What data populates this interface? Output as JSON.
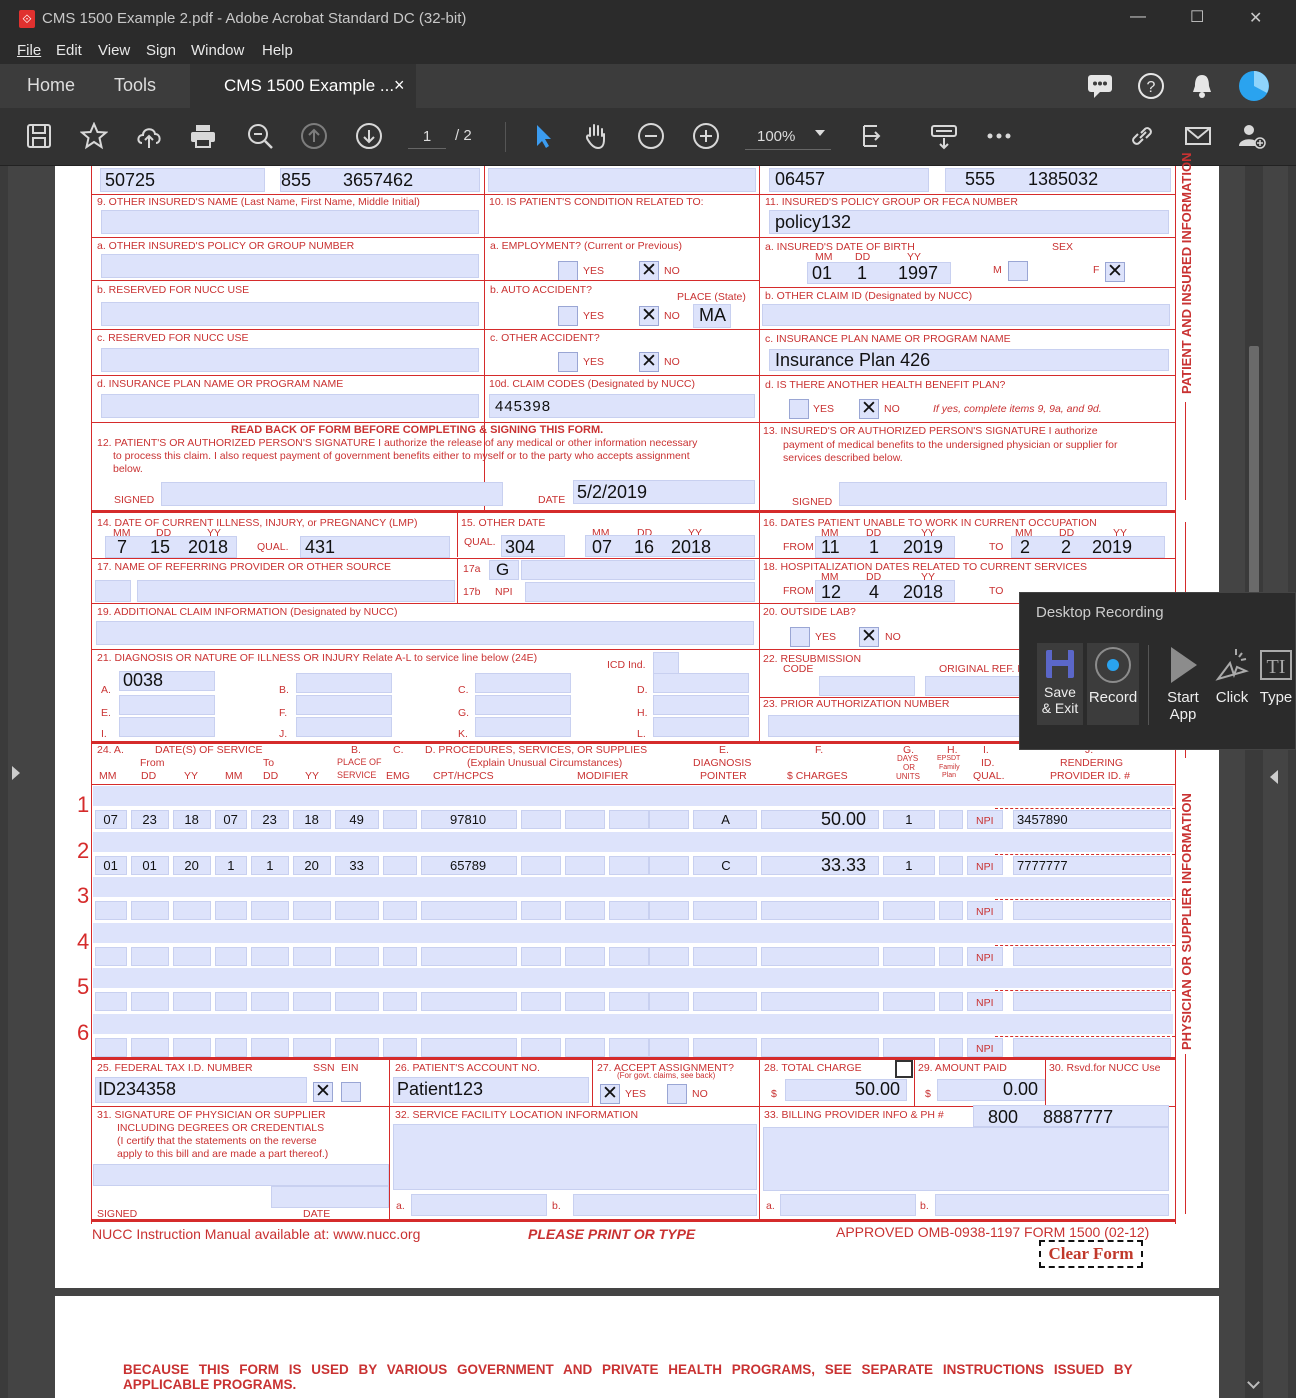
{
  "window": {
    "title": "CMS 1500 Example 2.pdf - Adobe Acrobat Standard DC (32-bit)",
    "min": "—",
    "max": "☐",
    "close": "✕"
  },
  "menu": [
    "File",
    "Edit",
    "View",
    "Sign",
    "Window",
    "Help"
  ],
  "tabs": {
    "home": "Home",
    "tools": "Tools",
    "doc": "CMS 1500 Example ...",
    "doc_close": "×"
  },
  "toolbar": {
    "page_current": "1",
    "page_total": "/ 2",
    "zoom": "100%"
  },
  "form": {
    "top": {
      "zip": "50725",
      "area": "855",
      "phone": "3657462",
      "ins_zip": "06457",
      "ins_area": "555",
      "ins_phone": "1385032"
    },
    "l9": "9. OTHER INSURED'S NAME (Last Name, First Name, Middle Initial)",
    "l9a": "a. OTHER INSURED'S POLICY OR GROUP NUMBER",
    "l9b": "b. RESERVED FOR NUCC USE",
    "l9c": "c. RESERVED FOR NUCC USE",
    "l9d": "d. INSURANCE PLAN NAME OR PROGRAM NAME",
    "l10": "10. IS PATIENT'S CONDITION RELATED TO:",
    "l10a": "a. EMPLOYMENT? (Current or Previous)",
    "l10b": "b. AUTO ACCIDENT?",
    "l10b_place": "PLACE (State)",
    "l10c": "c. OTHER ACCIDENT?",
    "l10d": "10d. CLAIM CODES (Designated by NUCC)",
    "yes": "YES",
    "no": "NO",
    "auto_state": "MA",
    "claim_codes": "445398",
    "l11": "11. INSURED'S POLICY GROUP OR FECA NUMBER",
    "policy": "policy132",
    "l11a": "a. INSURED'S DATE OF BIRTH",
    "sex": "SEX",
    "mm": "MM",
    "dd": "DD",
    "yy": "YY",
    "m": "M",
    "f": "F",
    "dob": {
      "mm": "01",
      "dd": "1",
      "yy": "1997"
    },
    "l11b": "b. OTHER CLAIM ID (Designated by NUCC)",
    "l11c": "c. INSURANCE PLAN NAME OR PROGRAM NAME",
    "plan": "Insurance Plan 426",
    "l11d": "d. IS THERE ANOTHER HEALTH BENEFIT PLAN?",
    "l11d_note": "If yes, complete items 9, 9a, and 9d.",
    "readback": "READ BACK OF FORM BEFORE COMPLETING & SIGNING THIS FORM.",
    "l12": "12. PATIENT'S OR AUTHORIZED PERSON'S SIGNATURE  I authorize the release of any medical or other information necessary",
    "l12b": "to process this claim. I also request payment of government benefits either to myself or to the party who accepts assignment",
    "l12c": "below.",
    "signed": "SIGNED",
    "date": "DATE",
    "sign_date": "5/2/2019",
    "l13": "13. INSURED'S OR AUTHORIZED PERSON'S SIGNATURE I authorize",
    "l13b": "payment of medical benefits to the undersigned physician or supplier for",
    "l13c": "services described below.",
    "l14": "14. DATE OF CURRENT ILLNESS, INJURY, or PREGNANCY (LMP)",
    "d14": {
      "mm": "7",
      "dd": "15",
      "yy": "2018",
      "qual": "431"
    },
    "qual": "QUAL.",
    "l15": "15. OTHER DATE",
    "d15": {
      "qual": "304",
      "mm": "07",
      "dd": "16",
      "yy": "2018"
    },
    "l16": "16. DATES PATIENT UNABLE TO WORK IN CURRENT OCCUPATION",
    "from": "FROM",
    "to": "TO",
    "d16": {
      "fmm": "11",
      "fdd": "1",
      "fyy": "2019",
      "tmm": "2",
      "tdd": "2",
      "tyy": "2019"
    },
    "l17": "17. NAME OF REFERRING PROVIDER OR OTHER SOURCE",
    "l17a": "17a",
    "l17b": "17b",
    "npi": "NPI",
    "v17a": "G",
    "l18": "18. HOSPITALIZATION DATES RELATED TO CURRENT SERVICES",
    "d18": {
      "fmm": "12",
      "fdd": "4",
      "fyy": "2018",
      "tmm": "1",
      "tdd": "3",
      "tyy": "2018"
    },
    "l19": "19. ADDITIONAL CLAIM INFORMATION (Designated by NUCC)",
    "l20": "20. OUTSIDE LAB?",
    "charges_lbl": "$ CHARGES",
    "l21": "21. DIAGNOSIS OR NATURE OF ILLNESS OR INJURY  Relate A-L to service line below (24E)",
    "icd": "ICD Ind.",
    "diag_a": "0038",
    "diag_letters": [
      "A.",
      "B.",
      "C.",
      "D.",
      "E.",
      "F.",
      "G.",
      "H.",
      "I.",
      "J.",
      "K.",
      "L."
    ],
    "l22": "22. RESUBMISSION",
    "l22b": "CODE",
    "l22c": "ORIGINAL REF. NO.",
    "l23": "23. PRIOR AUTHORIZATION NUMBER",
    "h24": {
      "a": "24.  A.",
      "dates": "DATE(S) OF SERVICE",
      "from": "From",
      "to": "To",
      "b": "B.",
      "pos": "PLACE OF",
      "svc": "SERVICE",
      "c": "C.",
      "emg": "EMG",
      "d": "D.  PROCEDURES, SERVICES, OR SUPPLIES",
      "d2": "(Explain Unusual Circumstances)",
      "cpt": "CPT/HCPCS",
      "mod": "MODIFIER",
      "e": "E.",
      "diag": "DIAGNOSIS",
      "ptr": "POINTER",
      "f": "F.",
      "chg": "$ CHARGES",
      "g": "G.",
      "days": "DAYS",
      "or": "OR",
      "units": "UNITS",
      "h": "H.",
      "epsdt": "EPSDT",
      "family": "Family",
      "plan": "Plan",
      "i": "I.",
      "id": "ID.",
      "iqual": "QUAL.",
      "j": "J.",
      "rend": "RENDERING",
      "prov": "PROVIDER ID. #"
    },
    "lines": [
      {
        "n": "1",
        "fmm": "07",
        "fdd": "23",
        "fyy": "18",
        "tmm": "07",
        "tdd": "23",
        "tyy": "18",
        "pos": "49",
        "cpt": "97810",
        "ptr": "A",
        "chg": "50.00",
        "units": "1",
        "prov": "3457890"
      },
      {
        "n": "2",
        "fmm": "01",
        "fdd": "01",
        "fyy": "20",
        "tmm": "1",
        "tdd": "1",
        "tyy": "20",
        "pos": "33",
        "cpt": "65789",
        "ptr": "C",
        "chg": "33.33",
        "units": "1",
        "prov": "7777777"
      },
      {
        "n": "3",
        "fmm": "",
        "fdd": "",
        "fyy": "",
        "tmm": "",
        "tdd": "",
        "tyy": "",
        "pos": "",
        "cpt": "",
        "ptr": "",
        "chg": "",
        "units": "",
        "prov": ""
      },
      {
        "n": "4",
        "fmm": "",
        "fdd": "",
        "fyy": "",
        "tmm": "",
        "tdd": "",
        "tyy": "",
        "pos": "",
        "cpt": "",
        "ptr": "",
        "chg": "",
        "units": "",
        "prov": ""
      },
      {
        "n": "5",
        "fmm": "",
        "fdd": "",
        "fyy": "",
        "tmm": "",
        "tdd": "",
        "tyy": "",
        "pos": "",
        "cpt": "",
        "ptr": "",
        "chg": "",
        "units": "",
        "prov": ""
      },
      {
        "n": "6",
        "fmm": "",
        "fdd": "",
        "fyy": "",
        "tmm": "",
        "tdd": "",
        "tyy": "",
        "pos": "",
        "cpt": "",
        "ptr": "",
        "chg": "",
        "units": "",
        "prov": ""
      }
    ],
    "l25": "25. FEDERAL TAX I.D. NUMBER",
    "ssn": "SSN",
    "ein": "EIN",
    "tax_id": "ID234358",
    "l26": "26. PATIENT'S ACCOUNT NO.",
    "acct": "Patient123",
    "l27": "27. ACCEPT ASSIGNMENT?",
    "l27b": "(For govt. claims, see back)",
    "l28": "28. TOTAL CHARGE",
    "total": "50.00",
    "dollar": "$",
    "l29": "29. AMOUNT PAID",
    "paid": "0.00",
    "l30": "30. Rsvd.for NUCC Use",
    "l31": "31. SIGNATURE OF PHYSICIAN OR SUPPLIER",
    "l31b": "INCLUDING DEGREES OR CREDENTIALS",
    "l31c": "(I certify that the statements on the reverse",
    "l31d": "apply to this bill and are made a part thereof.)",
    "l32": "32. SERVICE FACILITY LOCATION INFORMATION",
    "l33": "33. BILLING PROVIDER INFO & PH #",
    "bill_area": "800",
    "bill_phone": "8887777",
    "a": "a.",
    "b": "b.",
    "side1": "PATIENT AND INSURED INFORMATION",
    "side2": "PHYSICIAN OR SUPPLIER INFORMATION",
    "footer_left": "NUCC Instruction Manual available at: www.nucc.org",
    "footer_mid": "PLEASE PRINT OR TYPE",
    "footer_right": "APPROVED OMB-0938-1197 FORM 1500 (02-12)",
    "clear": "Clear Form",
    "page2": "BECAUSE THIS FORM IS USED BY VARIOUS GOVERNMENT AND PRIVATE HEALTH PROGRAMS, SEE SEPARATE INSTRUCTIONS ISSUED BY",
    "page2b": "APPLICABLE PROGRAMS."
  },
  "recorder": {
    "title": "Desktop Recording",
    "save": "Save",
    "save2": "& Exit",
    "record": "Record",
    "start": "Start",
    "start2": "App",
    "click": "Click",
    "type": "Type"
  },
  "colors": {
    "form_red": "#d52b2b",
    "field": "#dde3fb",
    "accent": "#2aa3ef"
  }
}
